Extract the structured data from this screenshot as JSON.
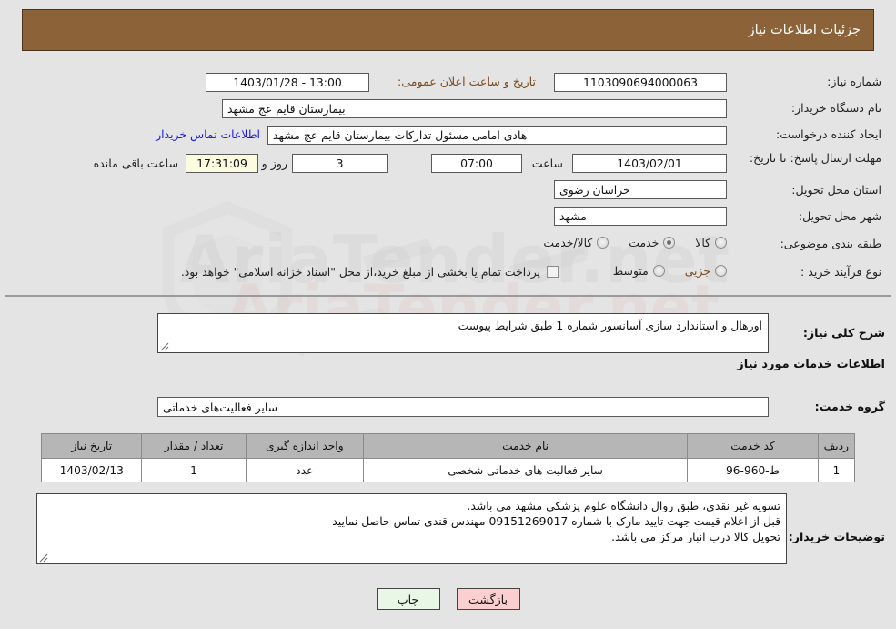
{
  "header": {
    "title": "جزئیات اطلاعات نیاز"
  },
  "form": {
    "need_number_label": "شماره نیاز:",
    "need_number_value": "1103090694000063",
    "announce_label": "تاریخ و ساعت اعلان عمومی:",
    "announce_value": "13:00 - 1403/01/28",
    "buyer_org_label": "نام دستگاه خریدار:",
    "buyer_org_value": "بیمارستان قایم  عج  مشهد",
    "requester_label": "ایجاد کننده درخواست:",
    "requester_value": "هادی امامی مسئول تدارکات بیمارستان قایم  عج  مشهد",
    "buyer_contact_link": "اطلاعات تماس خریدار",
    "deadline_label": "مهلت ارسال پاسخ: تا تاریخ:",
    "deadline_date": "1403/02/01",
    "hour_label": "ساعت",
    "deadline_time": "07:00",
    "days_value": "3",
    "days_label": "روز و",
    "countdown_value": "17:31:09",
    "remaining_label": "ساعت باقی مانده",
    "province_label": "استان محل تحویل:",
    "province_value": "خراسان رضوی",
    "city_label": "شهر محل تحویل:",
    "city_value": "مشهد",
    "category_label": "طبقه بندی موضوعی:",
    "category_options": [
      "کالا",
      "خدمت",
      "کالا/خدمت"
    ],
    "category_selected": "خدمت",
    "process_label": "نوع فرآیند خرید :",
    "process_options": [
      "جزیی",
      "متوسط"
    ],
    "process_selected": "جزیی",
    "treasury_note": "پرداخت تمام یا بخشی از مبلغ خرید،از محل \"اسناد خزانه اسلامی\" خواهد بود.",
    "treasury_checked": false
  },
  "description": {
    "label": "شرح کلی نیاز:",
    "value": "اورهال و استاندارد سازی آسانسور شماره 1 طبق شرایط پیوست"
  },
  "services": {
    "section_title": "اطلاعات خدمات مورد نیاز",
    "group_label": "گروه خدمت:",
    "group_value": "سایر فعالیت‌های خدماتی",
    "table": {
      "headers": [
        "ردیف",
        "کد خدمت",
        "نام خدمت",
        "واحد اندازه گیری",
        "تعداد / مقدار",
        "تاریخ نیاز"
      ],
      "rows": [
        {
          "row": "1",
          "code": "ط-960-96",
          "name": "سایر فعالیت های خدماتی شخصی",
          "unit": "عدد",
          "qty": "1",
          "date": "1403/02/13"
        }
      ]
    }
  },
  "buyer_notes": {
    "label": "توضیحات خریدار:",
    "lines": [
      "تسویه غیر نقدی، طبق روال دانشگاه علوم پزشکی مشهد می باشد.",
      "قبل از اعلام قیمت جهت تایید مارک با شماره 09151269017 مهندس قندی تماس حاصل نمایید",
      "تحویل کالا درب انبار مرکز می باشد."
    ]
  },
  "buttons": {
    "print": "چاپ",
    "back": "بازگشت"
  },
  "watermark": {
    "text": "AriaTender.net"
  },
  "colors": {
    "header_bg": "#8c6239",
    "link": "#1818e0",
    "label_brown": "#7a4a1e",
    "table_header": "#b6b6b6",
    "btn_print": "#e9f7e6",
    "btn_back": "#fbcfcf",
    "countdown_bg": "#fbfbe0"
  }
}
